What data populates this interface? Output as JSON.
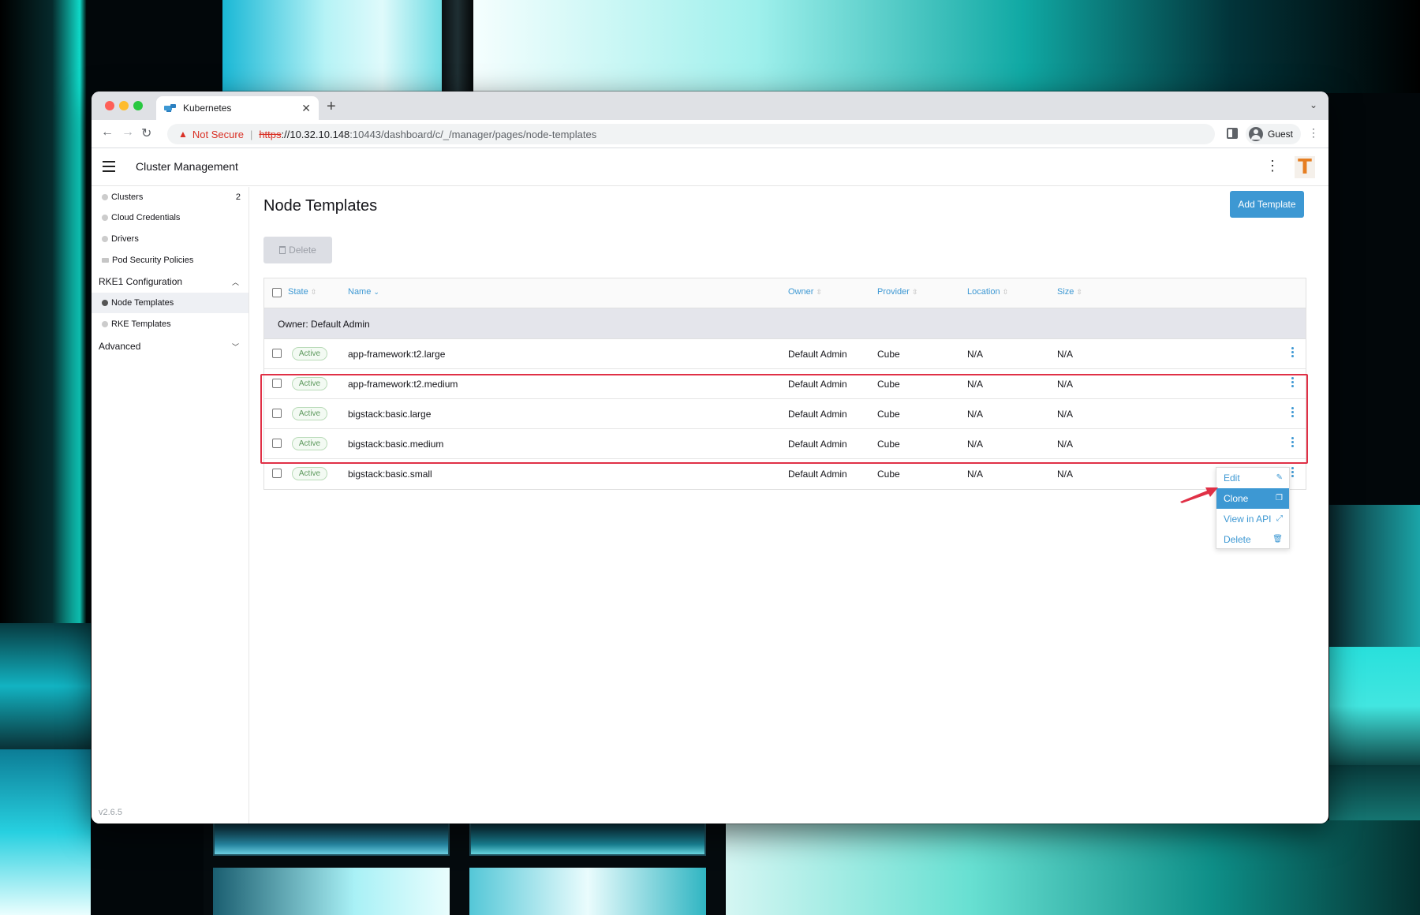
{
  "browser": {
    "tab_title": "Kubernetes",
    "new_tab": "+",
    "security_label": "Not Secure",
    "url_scheme": "https",
    "url_host": "://10.32.10.148",
    "url_path": ":10443/dashboard/c/_/manager/pages/node-templates",
    "profile_name": "Guest"
  },
  "app": {
    "title": "Cluster Management",
    "avatar_letter": "T",
    "accent_color": "#3d98d3",
    "version": "v2.6.5"
  },
  "sidebar": {
    "items": [
      {
        "label": "Clusters",
        "count": "2"
      },
      {
        "label": "Cloud Credentials"
      },
      {
        "label": "Drivers"
      },
      {
        "label": "Pod Security Policies"
      }
    ],
    "group_rke1": "RKE1 Configuration",
    "rke1_items": [
      {
        "label": "Node Templates"
      },
      {
        "label": "RKE Templates"
      }
    ],
    "group_advanced": "Advanced"
  },
  "main": {
    "page_title": "Node Templates",
    "add_button": "Add Template",
    "bulk_delete": "Delete",
    "columns": [
      "State",
      "Name",
      "Owner",
      "Provider",
      "Location",
      "Size"
    ],
    "group_label": "Owner: Default Admin",
    "rows": [
      {
        "state": "Active",
        "name": "app-framework:t2.large",
        "owner": "Default Admin",
        "provider": "Cube",
        "location": "N/A",
        "size": "N/A"
      },
      {
        "state": "Active",
        "name": "app-framework:t2.medium",
        "owner": "Default Admin",
        "provider": "Cube",
        "location": "N/A",
        "size": "N/A"
      },
      {
        "state": "Active",
        "name": "bigstack:basic.large",
        "owner": "Default Admin",
        "provider": "Cube",
        "location": "N/A",
        "size": "N/A"
      },
      {
        "state": "Active",
        "name": "bigstack:basic.medium",
        "owner": "Default Admin",
        "provider": "Cube",
        "location": "N/A",
        "size": "N/A"
      },
      {
        "state": "Active",
        "name": "bigstack:basic.small",
        "owner": "Default Admin",
        "provider": "Cube",
        "location": "N/A",
        "size": "N/A"
      }
    ]
  },
  "context_menu": {
    "items": [
      "Edit",
      "Clone",
      "View in API",
      "Delete"
    ],
    "active_item": "Clone"
  }
}
